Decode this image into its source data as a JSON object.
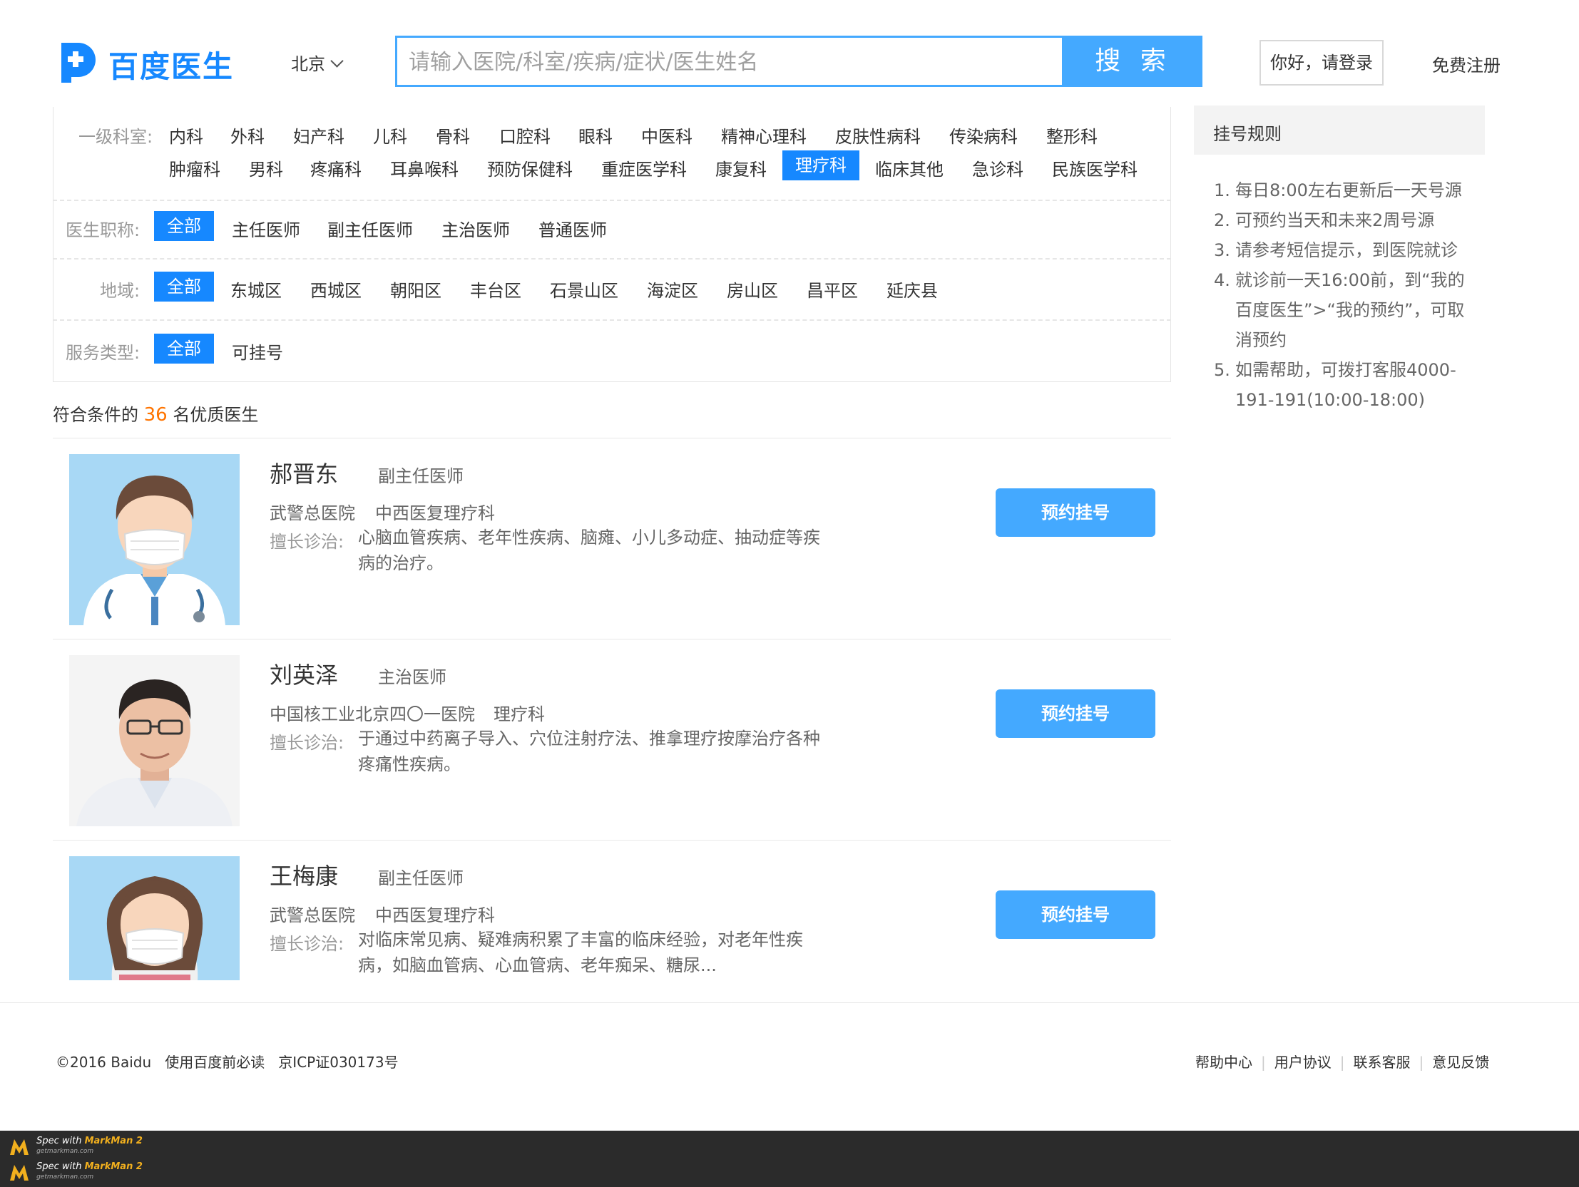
{
  "header": {
    "logo_text": "百度医生",
    "city": "北京",
    "search_placeholder": "请输入医院/科室/疾病/症状/医生姓名",
    "search_button": "搜 索",
    "login_button": "你好，请登录",
    "register_link": "免费注册"
  },
  "filters": {
    "department": {
      "label": "一级科室:",
      "row1": [
        "内科",
        "外科",
        "妇产科",
        "儿科",
        "骨科",
        "口腔科",
        "眼科",
        "中医科",
        "精神心理科",
        "皮肤性病科",
        "传染病科",
        "整形科"
      ],
      "row2": [
        "肿瘤科",
        "男科",
        "疼痛科",
        "耳鼻喉科",
        "预防保健科",
        "重症医学科",
        "康复科",
        "理疗科",
        "临床其他",
        "急诊科",
        "民族医学科"
      ],
      "selected": "理疗科"
    },
    "title": {
      "label": "医生职称:",
      "options": [
        "全部",
        "主任医师",
        "副主任医师",
        "主治医师",
        "普通医师"
      ],
      "selected": "全部"
    },
    "region": {
      "label": "地域:",
      "options": [
        "全部",
        "东城区",
        "西城区",
        "朝阳区",
        "丰台区",
        "石景山区",
        "海淀区",
        "房山区",
        "昌平区",
        "延庆县"
      ],
      "selected": "全部"
    },
    "service": {
      "label": "服务类型:",
      "options": [
        "全部",
        "可挂号"
      ],
      "selected": "全部"
    }
  },
  "results": {
    "prefix": "符合条件的",
    "count": "36",
    "suffix": "名优质医生"
  },
  "doctors": [
    {
      "name": "郝晋东",
      "title": "副主任医师",
      "hospital": "武警总医院",
      "department": "中西医复理疗科",
      "specialty_label": "擅长诊治:",
      "specialty": "心脑血管疾病、老年性疾病、脑瘫、小儿多动症、抽动症等疾病的治疗。",
      "book_button": "预约挂号",
      "avatar": "male-doctor-icon"
    },
    {
      "name": "刘英泽",
      "title": "主治医师",
      "hospital": "中国核工业北京四〇一医院",
      "department": "理疗科",
      "specialty_label": "擅长诊治:",
      "specialty": "于通过中药离子导入、穴位注射疗法、推拿理疗按摩治疗各种疼痛性疾病。",
      "book_button": "预约挂号",
      "avatar": "doctor-photo"
    },
    {
      "name": "王梅康",
      "title": "副主任医师",
      "hospital": "武警总医院",
      "department": "中西医复理疗科",
      "specialty_label": "擅长诊治:",
      "specialty": "对临床常见病、疑难病积累了丰富的临床经验，对老年性疾病，如脑血管病、心血管病、老年痴呆、糖尿...",
      "book_button": "预约挂号",
      "avatar": "female-doctor-icon"
    }
  ],
  "rules": {
    "title": "挂号规则",
    "items": [
      "每日8:00左右更新后一天号源",
      "可预约当天和未来2周号源",
      "请参考短信提示，到医院就诊",
      "就诊前一天16:00前，到“我的百度医生”>“我的预约”，可取消预约",
      "如需帮助，可拨打客服4000-191-191(10:00-18:00)"
    ]
  },
  "footer": {
    "copyright": "©2016 Baidu   使用百度前必读   京ICP证030173号",
    "links": [
      "帮助中心",
      "用户协议",
      "联系客服",
      "意见反馈"
    ]
  },
  "markman": {
    "line1_prefix": "Spec with ",
    "line1_brand": "MarkMan 2",
    "line1_sub": "getmarkman.com"
  },
  "colors": {
    "primary": "#1688ff",
    "button": "#44a9ff",
    "highlight": "#ff7400",
    "text_secondary": "#666666",
    "text_muted": "#999999",
    "rules_header_bg": "#f3f3f3"
  }
}
